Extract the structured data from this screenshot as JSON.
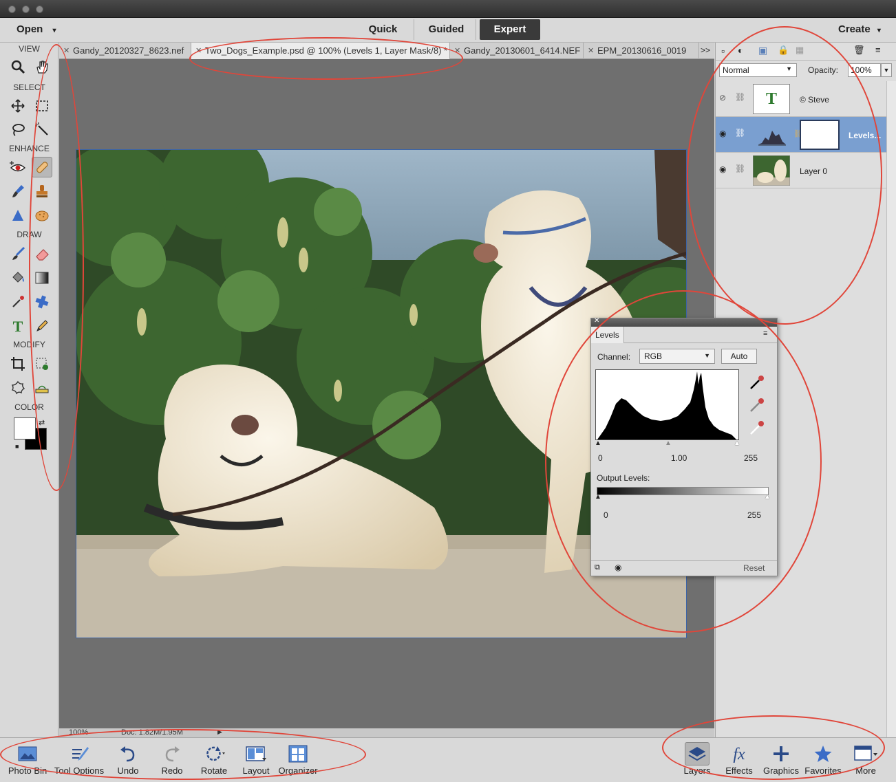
{
  "topbar": {
    "open": "Open",
    "create": "Create",
    "modes": [
      "Quick",
      "Guided",
      "Expert"
    ],
    "active_mode": "Expert"
  },
  "toolbox": {
    "sections": {
      "view": "VIEW",
      "select": "SELECT",
      "enhance": "ENHANCE",
      "draw": "DRAW",
      "modify": "MODIFY",
      "color": "COLOR"
    },
    "tools": [
      "zoom-icon",
      "hand-icon",
      "move-icon",
      "marquee-icon",
      "lasso-icon",
      "magic-wand-icon",
      "red-eye-icon",
      "spot-healing-icon",
      "smart-brush-icon",
      "clone-stamp-icon",
      "blur-icon",
      "sponge-icon",
      "brush-icon",
      "eraser-icon",
      "paint-bucket-icon",
      "gradient-icon",
      "eyedropper-icon",
      "custom-shape-icon",
      "type-icon",
      "pencil-icon",
      "crop-icon",
      "recompose-icon",
      "cookie-cutter-icon",
      "straighten-icon"
    ]
  },
  "tabs": [
    {
      "label": "Gandy_20120327_8623.nef"
    },
    {
      "label": "Two_Dogs_Example.psd @ 100% (Levels 1, Layer Mask/8) *"
    },
    {
      "label": "Gandy_20130601_6414.NEF"
    },
    {
      "label": "EPM_20130616_0019"
    }
  ],
  "tabs_overflow": ">>",
  "status": {
    "zoom": "100%",
    "doc": "Doc: 1.82M/1.95M"
  },
  "layers_panel": {
    "blend_mode": "Normal",
    "opacity_label": "Opacity:",
    "opacity_value": "100%",
    "layers": [
      {
        "name": "© Steve",
        "thumb": "T"
      },
      {
        "name": "Levels..."
      },
      {
        "name": "Layer 0"
      }
    ]
  },
  "levels_panel": {
    "title": "Levels",
    "channel_label": "Channel:",
    "channel_value": "RGB",
    "auto": "Auto",
    "input_values": [
      "0",
      "1.00",
      "255"
    ],
    "output_label": "Output Levels:",
    "output_values": [
      "0",
      "255"
    ],
    "reset": "Reset"
  },
  "bottom_left": [
    {
      "label": "Photo Bin",
      "icon": "photo-bin-icon"
    },
    {
      "label": "Tool Options",
      "icon": "tool-options-icon"
    },
    {
      "label": "Undo",
      "icon": "undo-icon"
    },
    {
      "label": "Redo",
      "icon": "redo-icon"
    },
    {
      "label": "Rotate",
      "icon": "rotate-icon"
    },
    {
      "label": "Layout",
      "icon": "layout-icon"
    },
    {
      "label": "Organizer",
      "icon": "organizer-icon"
    }
  ],
  "bottom_right": [
    {
      "label": "Layers",
      "icon": "layers-icon"
    },
    {
      "label": "Effects",
      "icon": "effects-icon"
    },
    {
      "label": "Graphics",
      "icon": "graphics-icon"
    },
    {
      "label": "Favorites",
      "icon": "favorites-icon"
    },
    {
      "label": "More",
      "icon": "more-icon"
    }
  ],
  "colors": {
    "accent": "#3a63a8",
    "selected_layer": "#7a9fd0",
    "annotation": "#e0463a"
  }
}
